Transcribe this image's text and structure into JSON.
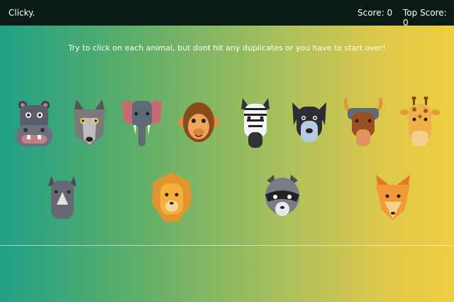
{
  "navbar": {
    "brand": "Clicky.",
    "score_label": "Score: 0",
    "top_score_label": "Top Score: 0"
  },
  "instructions": "Try to click on each animal, but dont hit any duplicates or you have to start over!",
  "game": {
    "score": 0,
    "top_score": 0,
    "cards": [
      {
        "animal": "hippo"
      },
      {
        "animal": "wolf"
      },
      {
        "animal": "elephant"
      },
      {
        "animal": "monkey"
      },
      {
        "animal": "zebra"
      },
      {
        "animal": "dog"
      },
      {
        "animal": "buffalo"
      },
      {
        "animal": "giraffe"
      },
      {
        "animal": "rhino"
      },
      {
        "animal": "lion"
      },
      {
        "animal": "raccoon"
      },
      {
        "animal": "fox"
      }
    ]
  },
  "colors": {
    "navbar_bg": "#0a1a17",
    "gradient_left": "#1fa184",
    "gradient_right": "#f0cf40"
  }
}
